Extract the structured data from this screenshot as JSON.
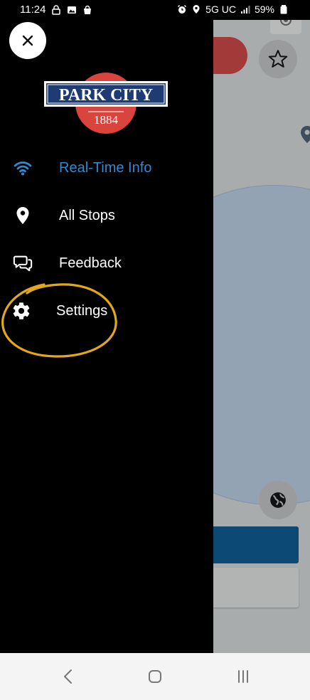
{
  "status_bar": {
    "time": "11:24",
    "network": "5G UC",
    "battery": "59%"
  },
  "drawer": {
    "logo": {
      "name": "PARK CITY",
      "year": "1884"
    },
    "menu": [
      {
        "id": "realtime",
        "label": "Real-Time Info",
        "icon": "wifi-icon",
        "active": true
      },
      {
        "id": "stops",
        "label": "All Stops",
        "icon": "map-pin-icon",
        "active": false
      },
      {
        "id": "feedback",
        "label": "Feedback",
        "icon": "chat-bubbles-icon",
        "active": false
      },
      {
        "id": "settings",
        "label": "Settings",
        "icon": "gear-icon",
        "active": false
      }
    ]
  },
  "colors": {
    "active_item": "#2f8ad1",
    "annotation": "#e2a818",
    "logo_red": "#d9453c",
    "logo_navy": "#1f3b73"
  }
}
